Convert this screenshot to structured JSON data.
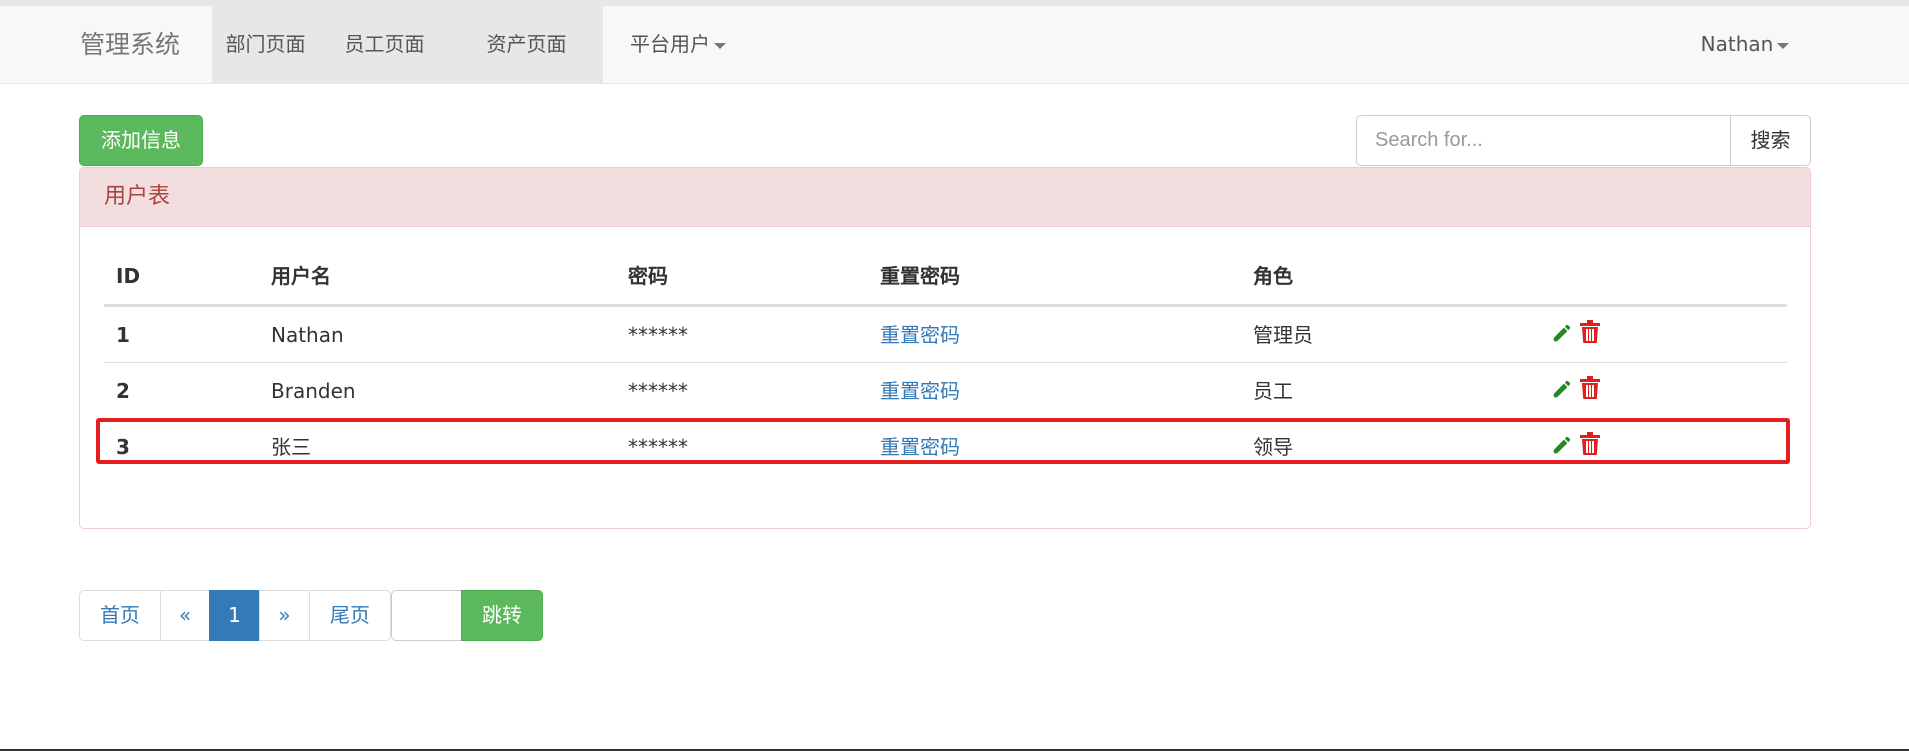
{
  "navbar": {
    "brand": "管理系统",
    "items": [
      {
        "label": "部门页面"
      },
      {
        "label": "员工页面"
      },
      {
        "label": "资产页面"
      },
      {
        "label": "平台用户"
      }
    ],
    "user": "Nathan"
  },
  "toolbar": {
    "add_label": "添加信息",
    "search_placeholder": "Search for...",
    "search_value": "",
    "search_label": "搜索"
  },
  "panel": {
    "title": "用户表"
  },
  "table": {
    "headers": [
      "ID",
      "用户名",
      "密码",
      "重置密码",
      "角色"
    ],
    "rows": [
      {
        "id": "1",
        "username": "Nathan",
        "password": "******",
        "reset": "重置密码",
        "role": "管理员"
      },
      {
        "id": "2",
        "username": "Branden",
        "password": "******",
        "reset": "重置密码",
        "role": "员工"
      },
      {
        "id": "3",
        "username": "张三",
        "password": "******",
        "reset": "重置密码",
        "role": "领导"
      }
    ]
  },
  "pagination": {
    "first": "首页",
    "prev": "«",
    "current": "1",
    "next": "»",
    "last": "尾页",
    "jump_value": "",
    "jump_label": "跳转"
  },
  "icons": {
    "edit": "pencil-icon",
    "delete": "trash-icon"
  },
  "colors": {
    "success": "#5cb85c",
    "primary": "#337ab7",
    "danger_heading": "#f2dede",
    "danger_text": "#a94442",
    "edit_icon": "#1e8a1e",
    "delete_icon": "#e02020",
    "highlight": "#e41e1e"
  }
}
